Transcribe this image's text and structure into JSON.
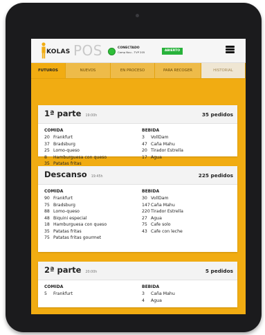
{
  "app": {
    "logo_text": "KOLAS",
    "product": "POS",
    "status_title": "CONECTADO",
    "status_sub": "Camp Nou - TVP 205",
    "open_badge": "ABIERTO"
  },
  "tabs": [
    {
      "label": "FUTUROS",
      "active": true
    },
    {
      "label": "NUEVOS",
      "active": false
    },
    {
      "label": "EN PROCESO",
      "active": false
    },
    {
      "label": "PARA RECOGER",
      "active": false
    },
    {
      "label": "HISTORIAL",
      "active": false
    }
  ],
  "cards": [
    {
      "title": "1ª parte",
      "time": "19:00h",
      "count": "35 pedidos",
      "food_title": "COMIDA",
      "drink_title": "BEBIDA",
      "food": [
        {
          "qty": "20",
          "name": "Frankfurt"
        },
        {
          "qty": "37",
          "name": "Bradsburg"
        },
        {
          "qty": "25",
          "name": "Lomo-queso"
        },
        {
          "qty": "8",
          "name": "Hamburguesa con queso"
        },
        {
          "qty": "35",
          "name": "Patatas fritas"
        }
      ],
      "drink": [
        {
          "qty": "3",
          "name": "VollDam"
        },
        {
          "qty": "47",
          "name": "Caña Mahu"
        },
        {
          "qty": "20",
          "name": "Tirador Estrella"
        },
        {
          "qty": "17",
          "name": "Agua"
        }
      ]
    },
    {
      "title": "Descanso",
      "time": "19:45h",
      "count": "225 pedidos",
      "food_title": "COMIDA",
      "drink_title": "BEBIDA",
      "food": [
        {
          "qty": "90",
          "name": "Frankfurt"
        },
        {
          "qty": "75",
          "name": "Bradsburg"
        },
        {
          "qty": "88",
          "name": "Lomo-queso"
        },
        {
          "qty": "48",
          "name": "Biquini especial"
        },
        {
          "qty": "18",
          "name": "Hamburguesa con queso"
        },
        {
          "qty": "35",
          "name": "Patatas fritas"
        },
        {
          "qty": "75",
          "name": "Patatas fritas gourmet"
        }
      ],
      "drink": [
        {
          "qty": "30",
          "name": "VollDam"
        },
        {
          "qty": "147",
          "name": "Caña Mahu"
        },
        {
          "qty": "220",
          "name": "Tirador Estrella"
        },
        {
          "qty": "27",
          "name": "Agua"
        },
        {
          "qty": "75",
          "name": "Cafe solo"
        },
        {
          "qty": "43",
          "name": "Cafe con leche"
        }
      ]
    },
    {
      "title": "2ª parte",
      "time": "20:00h",
      "count": "5 pedidos",
      "food_title": "COMIDA",
      "drink_title": "BEBIDA",
      "food": [
        {
          "qty": "5",
          "name": "Frankfurt"
        }
      ],
      "drink": [
        {
          "qty": "3",
          "name": "Caña Mahu"
        },
        {
          "qty": "4",
          "name": "Agua"
        }
      ]
    }
  ],
  "colors": {
    "accent": "#f1ac12",
    "connected": "#2fbf39",
    "open_badge": "#28b23b"
  }
}
